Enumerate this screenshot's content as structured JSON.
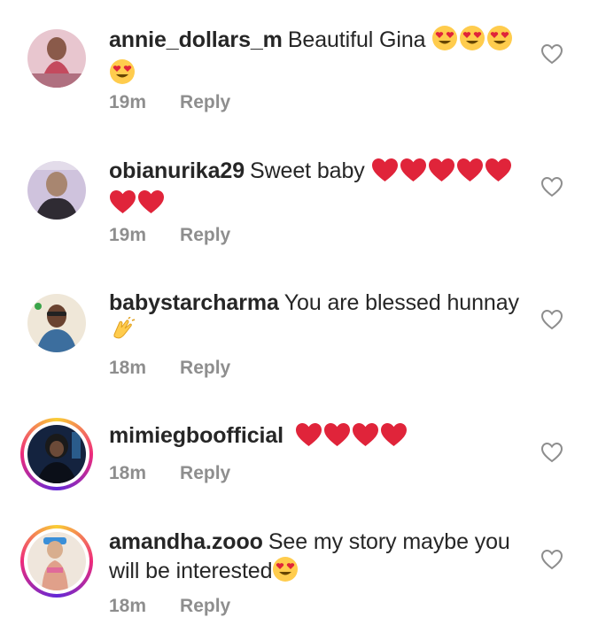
{
  "comments": [
    {
      "username": "annie_dollars_m",
      "text": "Beautiful Gina",
      "emojis": [
        "heart-eyes",
        "heart-eyes",
        "heart-eyes",
        "heart-eyes"
      ],
      "time": "19m",
      "reply_label": "Reply",
      "has_story": false,
      "avatar_colors": [
        "#d98aa0",
        "#6b4a55"
      ]
    },
    {
      "username": "obianurika29",
      "text": "Sweet baby",
      "emojis": [
        "red-heart",
        "red-heart",
        "red-heart",
        "red-heart",
        "red-heart",
        "red-heart",
        "red-heart"
      ],
      "time": "19m",
      "reply_label": "Reply",
      "has_story": false,
      "avatar_colors": [
        "#c7b9d9",
        "#3a3640"
      ]
    },
    {
      "username": "babystarcharma",
      "text": "You are blessed hunnay",
      "emojis": [
        "clapping-hands"
      ],
      "time": "18m",
      "reply_label": "Reply",
      "has_story": false,
      "avatar_colors": [
        "#e7dcc9",
        "#3c6e9e"
      ]
    },
    {
      "username": "mimiegboofficial",
      "text": "",
      "emojis": [
        "red-heart",
        "red-heart",
        "red-heart",
        "red-heart"
      ],
      "time": "18m",
      "reply_label": "Reply",
      "has_story": true,
      "avatar_colors": [
        "#1a2a4a",
        "#0d1420"
      ]
    },
    {
      "username": "amandha.zooo",
      "text": "See my story maybe you will be interested",
      "emojis": [
        "heart-eyes"
      ],
      "time": "18m",
      "reply_label": "Reply",
      "has_story": true,
      "avatar_colors": [
        "#e8d4c4",
        "#c89a7a"
      ]
    }
  ],
  "colors": {
    "text": "#262626",
    "muted": "#8e8e8e",
    "heart_red": "#e0243a",
    "emoji_yellow": "#ffcc4d"
  }
}
